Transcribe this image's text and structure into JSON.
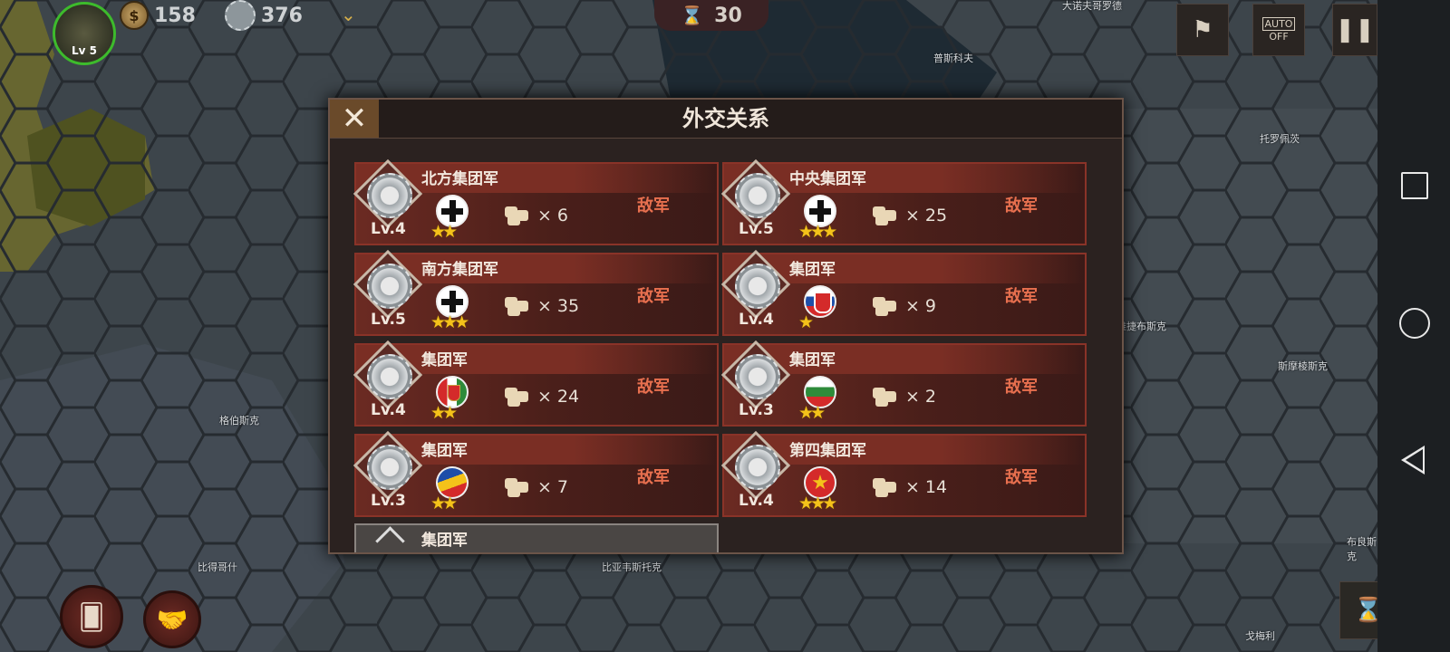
{
  "hud": {
    "level": "Lv 5",
    "coins": "158",
    "industry": "376",
    "turn": "30",
    "auto_label": "AUTO",
    "auto_state": "OFF"
  },
  "map_labels": [
    "大诺夫哥罗德",
    "普斯科夫",
    "托罗佩茨",
    "维捷布斯克",
    "斯摩棱斯克",
    "格伯斯克",
    "比得哥什",
    "比亚韦斯托克",
    "布良斯克",
    "戈梅利"
  ],
  "dialog": {
    "title": "外交关系",
    "factions": [
      {
        "name": "北方集团军",
        "level": "Lv.4",
        "flag": "germany",
        "stars": "★★",
        "troops": "6",
        "status": "敌军"
      },
      {
        "name": "中央集团军",
        "level": "Lv.5",
        "flag": "germany",
        "stars": "★★★",
        "troops": "25",
        "status": "敌军"
      },
      {
        "name": "南方集团军",
        "level": "Lv.5",
        "flag": "germany",
        "stars": "★★★",
        "troops": "35",
        "status": "敌军"
      },
      {
        "name": "集团军",
        "level": "Lv.4",
        "flag": "slovakia",
        "stars": "★",
        "troops": "9",
        "status": "敌军"
      },
      {
        "name": "集团军",
        "level": "Lv.4",
        "flag": "hungary",
        "stars": "★★",
        "troops": "24",
        "status": "敌军"
      },
      {
        "name": "集团军",
        "level": "Lv.3",
        "flag": "bulgaria",
        "stars": "★★",
        "troops": "2",
        "status": "敌军"
      },
      {
        "name": "集团军",
        "level": "Lv.3",
        "flag": "romania",
        "stars": "★★",
        "troops": "7",
        "status": "敌军"
      },
      {
        "name": "第四集团军",
        "level": "Lv.4",
        "flag": "ussr",
        "stars": "★★★",
        "troops": "14",
        "status": "敌军"
      }
    ],
    "partial_row": {
      "name": "集团军"
    },
    "multiply_sign": "×"
  },
  "colors": {
    "enemy": "#e8704f",
    "star": "#f4c21a",
    "level_ring": "#3dbb2c"
  }
}
